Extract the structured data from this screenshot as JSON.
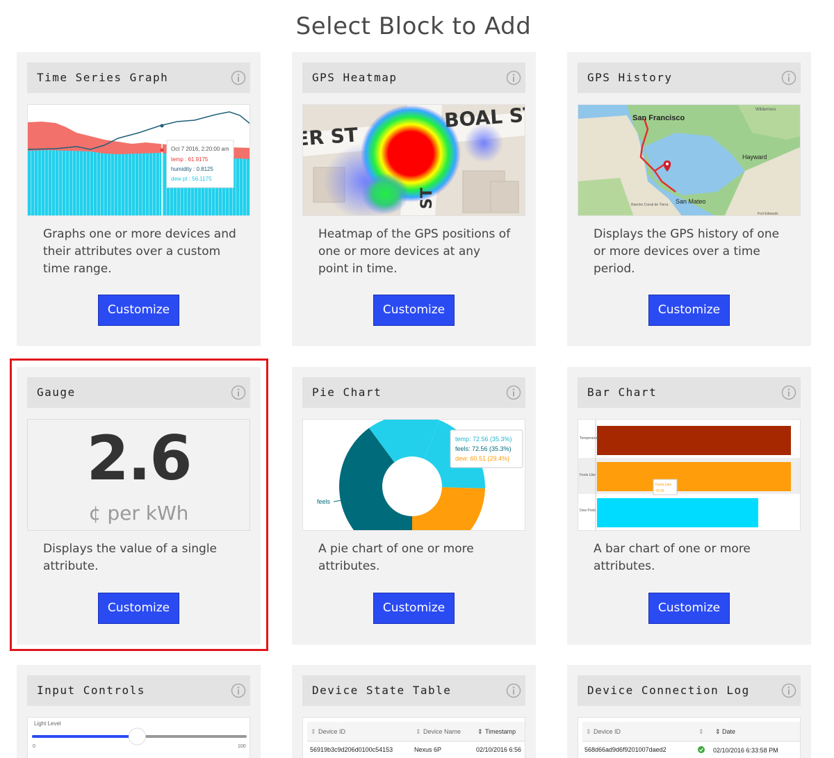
{
  "page": {
    "title": "Select Block to Add"
  },
  "customize_label": "Customize",
  "colors": {
    "button": "#2b4bf2",
    "highlight": "#e0151b",
    "card_bg": "#f2f2f2",
    "header_bg": "#e3e3e3"
  },
  "cards": [
    {
      "title": "Time Series Graph",
      "description": "Graphs one or more devices and their attributes over a custom time range.",
      "preview": {
        "tooltip_date": "Oct 7 2016, 2:20:00 am",
        "tooltip_temp": "temp : 61.9175",
        "tooltip_humidity": "humidity : 0.8125",
        "tooltip_dew": "dew pt : 56.1175"
      }
    },
    {
      "title": "GPS Heatmap",
      "description": "Heatmap of the GPS positions of one or more devices at any point in time.",
      "preview": {
        "street1": "BOAL ST",
        "street2": "ER ST",
        "street3": "ST"
      }
    },
    {
      "title": "GPS History",
      "description": "Displays the GPS history of one or more devices over a time period.",
      "preview": {
        "city1": "San Francisco",
        "city2": "Hayward",
        "city3": "San Mateo",
        "city4": "Wilderness",
        "city5": "Rancho Corral de Tierra",
        "city6": "Fort Edwards"
      }
    },
    {
      "title": "Gauge",
      "description": "Displays the value of a single attribute.",
      "preview": {
        "value": "2.6",
        "unit": "¢ per kWh"
      }
    },
    {
      "title": "Pie Chart",
      "description": "A pie chart of one or more attributes.",
      "preview": {
        "tip_temp": "temp: 72.56 (35.3%)",
        "tip_feels": "feels: 72.56 (35.3%)",
        "tip_dew": "dew: 60.51 (29.4%)",
        "slice_label": "feels"
      }
    },
    {
      "title": "Bar Chart",
      "description": "A bar chart of one or more attributes.",
      "preview": {
        "label1": "Temperature",
        "label2": "Feels Like",
        "label3": "Dew Point",
        "tip_label": "Feels Like:",
        "tip_value": "72.93"
      }
    },
    {
      "title": "Input Controls",
      "preview": {
        "slider_label": "Light Level",
        "slider_min": "0",
        "slider_max": "100",
        "slider_value": 0.49
      }
    },
    {
      "title": "Device State Table",
      "preview": {
        "col1": "Device ID",
        "col2": "Device Name",
        "col3": "Timestamp",
        "row_id": "56919b3c9d206d0100c54153",
        "row_name": "Nexus 6P",
        "row_time": "02/10/2016 6:56"
      }
    },
    {
      "title": "Device Connection Log",
      "preview": {
        "col1": "Device ID",
        "col2": "Date",
        "row_id": "568d66ad9d6f9201007daed2",
        "row_date": "02/10/2016 6:33:58 PM"
      }
    }
  ]
}
